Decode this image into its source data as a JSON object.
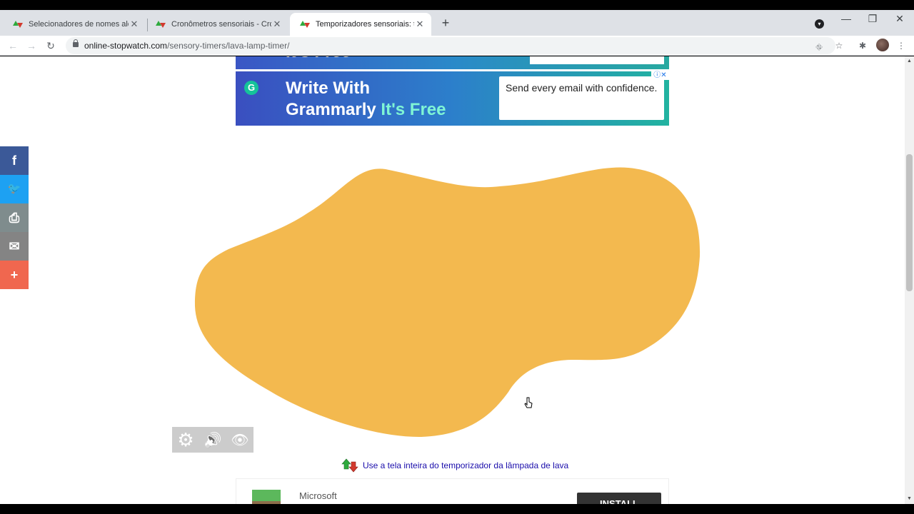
{
  "browser": {
    "tabs": [
      {
        "title": "Selecionadores de nomes aleató",
        "active": false
      },
      {
        "title": "Cronômetros sensoriais - Cronô",
        "active": false
      },
      {
        "title": "Temporizadores sensoriais: temp",
        "active": true
      }
    ],
    "tab_close_glyph": "✕",
    "new_tab_glyph": "+",
    "url_host": "online-stopwatch.com",
    "url_path": "/sensory-timers/lava-lamp-timer/"
  },
  "ads": {
    "top_partial_text": "It's Free",
    "grammarly": {
      "logo_letter": "G",
      "line1": "Write With",
      "line2_main": "Grammarly",
      "line2_accent": "It's Free",
      "box_text": "Send every email with confidence.",
      "adchoices_glyph": "ⓘ✕"
    },
    "microsoft": {
      "brand": "Microsoft",
      "install_label": "INSTALL"
    }
  },
  "social": [
    {
      "name": "facebook",
      "glyph": "f",
      "color": "#3b5998"
    },
    {
      "name": "twitter",
      "glyph": "🐦",
      "color": "#1da1f2"
    },
    {
      "name": "print",
      "glyph": "⎙",
      "color": "#7f8c8d"
    },
    {
      "name": "email",
      "glyph": "✉",
      "color": "#848484"
    },
    {
      "name": "more",
      "glyph": "+",
      "color": "#f0674f"
    }
  ],
  "lava": {
    "color": "#f3b94f"
  },
  "controls": {
    "settings_glyph": "⚙",
    "sound_glyph": "🔊",
    "view_glyph": "👁"
  },
  "fullscreen_link": "Use a tela inteira do temporizador da lâmpada de lava"
}
